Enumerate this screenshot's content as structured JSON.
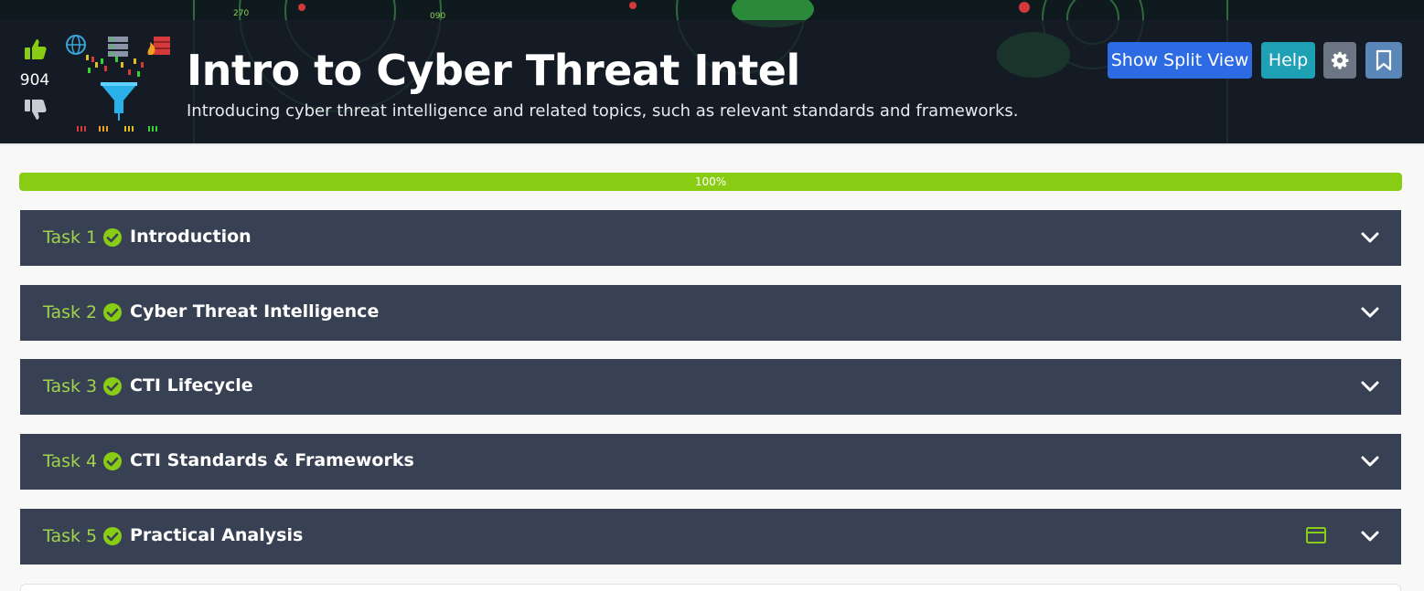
{
  "room": {
    "title": "Intro to Cyber Threat Intel",
    "description": "Introducing cyber threat intelligence and related topics, such as relevant standards and frameworks.",
    "vote_count": "904",
    "icons": {
      "upvote": "thumbs-up-icon",
      "downvote": "thumbs-down-icon",
      "room": "room-logo-funnel"
    }
  },
  "toolbar": {
    "split_view_label": "Show Split View",
    "help_label": "Help",
    "settings_icon": "gear-icon",
    "bookmark_icon": "bookmark-icon"
  },
  "progress": {
    "label": "100%",
    "value": 1.0
  },
  "tasks": [
    {
      "number_label": "Task 1",
      "title": "Introduction",
      "completed": true
    },
    {
      "number_label": "Task 2",
      "title": "Cyber Threat Intelligence",
      "completed": true
    },
    {
      "number_label": "Task 3",
      "title": "CTI Lifecycle",
      "completed": true
    },
    {
      "number_label": "Task 4",
      "title": "CTI Standards & Frameworks",
      "completed": true
    },
    {
      "number_label": "Task 5",
      "title": "Practical Analysis",
      "completed": true,
      "has_machine": true
    }
  ],
  "colors": {
    "accent_green": "#88cc14",
    "task_bg": "#384154",
    "split_view_button": "#2d6be4",
    "help_button": "#1ea0b5"
  }
}
